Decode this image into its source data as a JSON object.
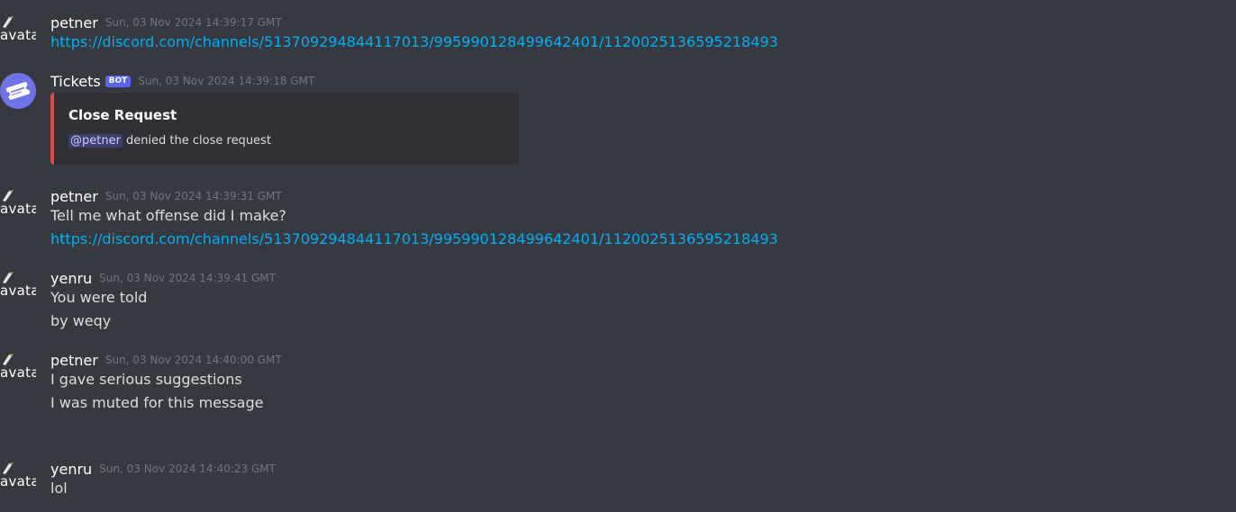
{
  "avatar_alt": "avatar",
  "messages": [
    {
      "username": "petner",
      "timestamp": "Sun, 03 Nov 2024 14:39:17 GMT",
      "lines": [
        "https://discord.com/channels/513709294844117013/995990128499642401/1120025136595218493"
      ]
    },
    {
      "username": "Tickets",
      "bot_tag": "BOT",
      "timestamp": "Sun, 03 Nov 2024 14:39:18 GMT",
      "embed": {
        "title": "Close Request",
        "mention": "@petner",
        "description": "denied the close request",
        "accent_color": "#ed4245"
      }
    },
    {
      "username": "petner",
      "timestamp": "Sun, 03 Nov 2024 14:39:31 GMT",
      "lines": [
        "Tell me what offense did I make?",
        "https://discord.com/channels/513709294844117013/995990128499642401/1120025136595218493"
      ]
    },
    {
      "username": "yenru",
      "timestamp": "Sun, 03 Nov 2024 14:39:41 GMT",
      "lines": [
        "You were told",
        "by weqy"
      ]
    },
    {
      "username": "petner",
      "timestamp": "Sun, 03 Nov 2024 14:40:00 GMT",
      "lines": [
        "I gave serious suggestions",
        "I was muted for this message"
      ]
    },
    {
      "username": "yenru",
      "timestamp": "Sun, 03 Nov 2024 14:40:23 GMT",
      "lines": [
        "lol"
      ]
    }
  ],
  "colors": {
    "background": "#36393f",
    "link": "#00aff4",
    "username": "#ffffff",
    "timestamp": "#72767d",
    "bot_tag": "#5865f2",
    "embed_background": "#2f3136"
  }
}
